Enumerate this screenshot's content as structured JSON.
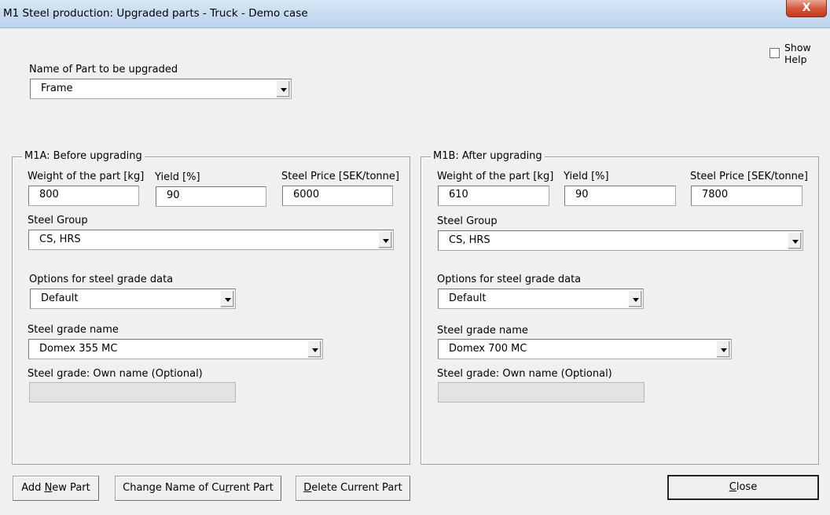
{
  "window": {
    "title": "M1 Steel production: Upgraded parts - Truck - Demo case",
    "close_glyph": "X"
  },
  "help": {
    "label_line1": "Show",
    "label_line2": "Help",
    "checked": false
  },
  "part": {
    "label": "Name of Part to be upgraded",
    "value": "Frame"
  },
  "before": {
    "legend": "M1A: Before upgrading",
    "weight_label": "Weight of the part [kg]",
    "weight_value": "800",
    "yield_label": "Yield [%]",
    "yield_value": "90",
    "price_label": "Steel Price [SEK/tonne]",
    "price_value": "6000",
    "group_label": "Steel Group",
    "group_value": "CS, HRS",
    "options_label": "Options for steel grade data",
    "options_value": "Default",
    "grade_label": "Steel grade name",
    "grade_value": "Domex 355 MC",
    "own_label": "Steel grade: Own name (Optional)",
    "own_value": ""
  },
  "after": {
    "legend": "M1B: After upgrading",
    "weight_label": "Weight of the part [kg]",
    "weight_value": "610",
    "yield_label": "Yield [%]",
    "yield_value": "90",
    "price_label": "Steel Price [SEK/tonne]",
    "price_value": "7800",
    "group_label": "Steel Group",
    "group_value": "CS, HRS",
    "options_label": "Options for steel grade data",
    "options_value": "Default",
    "grade_label": "Steel grade name",
    "grade_value": "Domex 700 MC",
    "own_label": "Steel grade: Own name (Optional)",
    "own_value": ""
  },
  "buttons": {
    "add_pre": "Add ",
    "add_accel": "N",
    "add_post": "ew Part",
    "change_pre": "Change Name of Cu",
    "change_accel": "r",
    "change_post": "rent Part",
    "delete_pre": "",
    "delete_accel": "D",
    "delete_post": "elete Current Part",
    "close_pre": "",
    "close_accel": "C",
    "close_post": "lose"
  }
}
